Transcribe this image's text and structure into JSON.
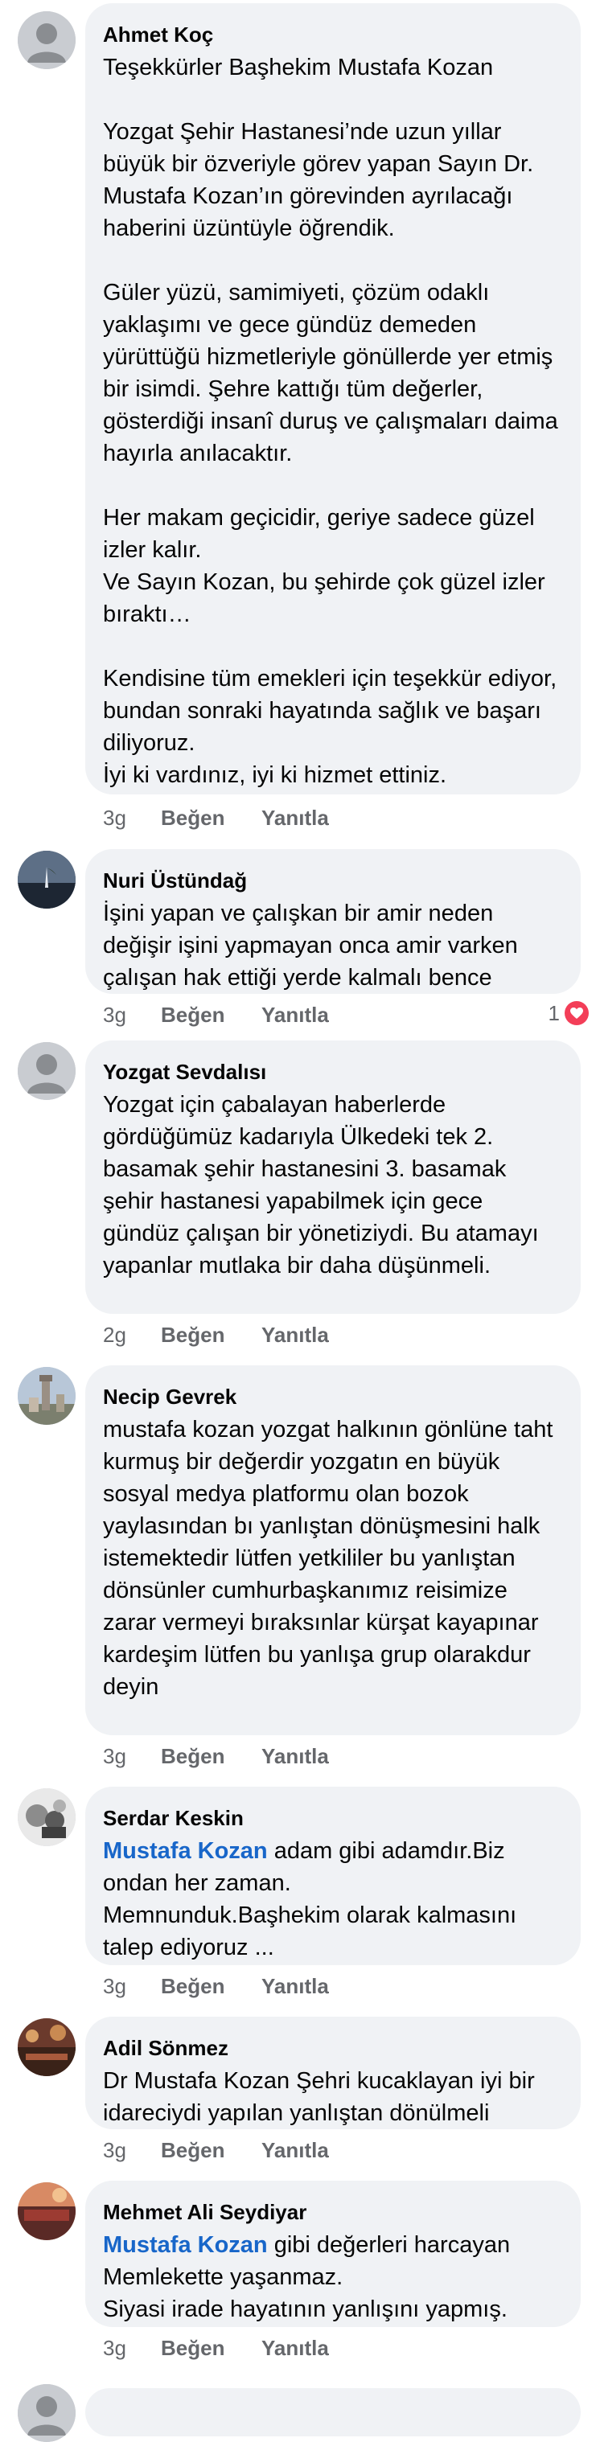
{
  "actions": {
    "like": "Beğen",
    "reply": "Yanıtla"
  },
  "comments": [
    {
      "author": "Ahmet Koç",
      "text": "Teşekkürler Başhekim Mustafa Kozan\n\nYozgat Şehir Hastanesi’nde uzun yıllar büyük bir özveriyle görev yapan Sayın Dr. Mustafa Kozan’ın görevinden ayrılacağı haberini üzüntüyle öğrendik.\n\nGüler yüzü, samimiyeti, çözüm odaklı yaklaşımı ve gece gündüz demeden yürüttüğü hizmetleriyle gönüllerde yer etmiş bir isimdi. Şehre kattığı tüm değerler, gösterdiği insanî duruş ve çalışmaları daima hayırla anılacaktır.\n\nHer makam geçicidir, geriye sadece güzel izler kalır.\nVe Sayın Kozan, bu şehirde çok güzel izler bıraktı…\n\nKendisine tüm emekleri için teşekkür ediyor, bundan sonraki hayatında sağlık ve başarı diliyoruz.\nİyi ki vardınız, iyi ki hizmet ettiniz.",
      "time": "3g"
    },
    {
      "author": "Nuri Üstündağ",
      "text": "İşini yapan ve çalışkan bir amir neden değişir işini yapmayan onca amir varken çalışan hak ettiği yerde kalmalı bence",
      "time": "3g",
      "reaction_count": "1"
    },
    {
      "author": "Yozgat Sevdalısı",
      "text": "Yozgat için çabalayan haberlerde gördüğümüz kadarıyla Ülkedeki tek 2. basamak şehir hastanesini 3. basamak şehir hastanesi yapabilmek için gece gündüz çalışan bir yönetiziydi. Bu atamayı yapanlar mutlaka bir daha düşünmeli.",
      "time": "2g"
    },
    {
      "author": "Necip Gevrek",
      "text": "mustafa kozan yozgat halkının gönlüne taht kurmuş bir değerdir yozgatın en büyük sosyal medya platformu olan bozok yaylasından bı yanlıştan dönüşmesini halk istemektedir lütfen yetkililer bu yanlıştan dönsünler cumhurbaşkanımız reisimize zarar vermeyi bıraksınlar kürşat kayapınar kardeşim lütfen bu yanlışa grup olarakdur deyin",
      "time": "3g"
    },
    {
      "author": "Serdar Keskin",
      "mention": "Mustafa Kozan",
      "text": " adam gibi adamdır.Biz ondan her zaman.\nMemnunduk.Başhekim olarak kalmasını talep ediyoruz ...",
      "time": "3g"
    },
    {
      "author": "Adil Sönmez",
      "text": "Dr Mustafa Kozan Şehri kucaklayan iyi bir idareciydi yapılan yanlıştan dönülmeli",
      "time": "3g"
    },
    {
      "author": "Mehmet Ali Seydiyar",
      "mention": "Mustafa Kozan",
      "text": " gibi değerleri harcayan Memlekette yaşanmaz.\nSiyasi irade hayatının yanlışını yapmış.",
      "time": "3g"
    }
  ]
}
